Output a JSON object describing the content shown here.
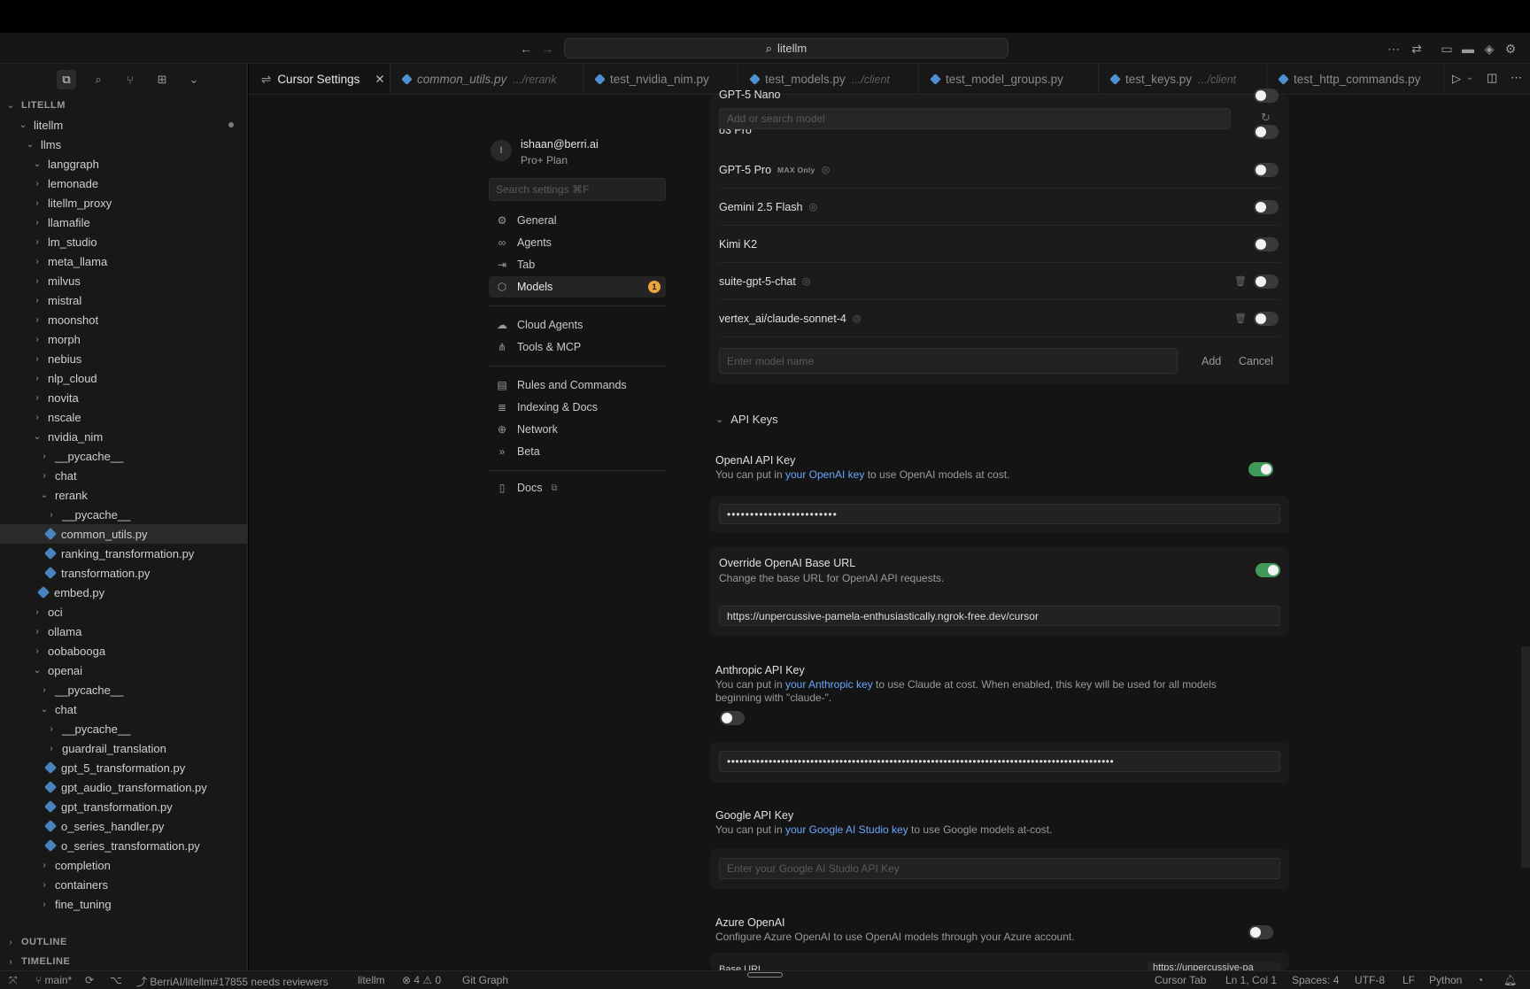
{
  "titlebar": {
    "search_text": "litellm",
    "icons": [
      "back-arrow-icon",
      "forward-arrow-icon",
      "search-icon",
      "more-icon",
      "sync-icon",
      "sidebar-toggle-icon",
      "panel-toggle-icon",
      "extensions-icon",
      "settings-gear-icon"
    ]
  },
  "sidebar": {
    "section_title": "LITELLM",
    "tree": [
      {
        "label": "litellm",
        "depth": 1,
        "type": "folder-open"
      },
      {
        "label": "llms",
        "depth": 2,
        "type": "folder-open"
      },
      {
        "label": "langgraph",
        "depth": 3,
        "type": "folder-open"
      },
      {
        "label": "lemonade",
        "depth": 3,
        "type": "folder"
      },
      {
        "label": "litellm_proxy",
        "depth": 3,
        "type": "folder"
      },
      {
        "label": "llamafile",
        "depth": 3,
        "type": "folder"
      },
      {
        "label": "lm_studio",
        "depth": 3,
        "type": "folder"
      },
      {
        "label": "meta_llama",
        "depth": 3,
        "type": "folder"
      },
      {
        "label": "milvus",
        "depth": 3,
        "type": "folder"
      },
      {
        "label": "mistral",
        "depth": 3,
        "type": "folder"
      },
      {
        "label": "moonshot",
        "depth": 3,
        "type": "folder"
      },
      {
        "label": "morph",
        "depth": 3,
        "type": "folder"
      },
      {
        "label": "nebius",
        "depth": 3,
        "type": "folder"
      },
      {
        "label": "nlp_cloud",
        "depth": 3,
        "type": "folder"
      },
      {
        "label": "novita",
        "depth": 3,
        "type": "folder"
      },
      {
        "label": "nscale",
        "depth": 3,
        "type": "folder"
      },
      {
        "label": "nvidia_nim",
        "depth": 3,
        "type": "folder-open"
      },
      {
        "label": "__pycache__",
        "depth": 4,
        "type": "folder"
      },
      {
        "label": "chat",
        "depth": 4,
        "type": "folder"
      },
      {
        "label": "rerank",
        "depth": 4,
        "type": "folder-open"
      },
      {
        "label": "__pycache__",
        "depth": 5,
        "type": "folder"
      },
      {
        "label": "common_utils.py",
        "depth": 5,
        "type": "file",
        "selected": true
      },
      {
        "label": "ranking_transformation.py",
        "depth": 5,
        "type": "file"
      },
      {
        "label": "transformation.py",
        "depth": 5,
        "type": "file"
      },
      {
        "label": "embed.py",
        "depth": 4,
        "type": "file"
      },
      {
        "label": "oci",
        "depth": 3,
        "type": "folder"
      },
      {
        "label": "ollama",
        "depth": 3,
        "type": "folder"
      },
      {
        "label": "oobabooga",
        "depth": 3,
        "type": "folder"
      },
      {
        "label": "openai",
        "depth": 3,
        "type": "folder-open"
      },
      {
        "label": "__pycache__",
        "depth": 4,
        "type": "folder"
      },
      {
        "label": "chat",
        "depth": 4,
        "type": "folder-open"
      },
      {
        "label": "__pycache__",
        "depth": 5,
        "type": "folder"
      },
      {
        "label": "guardrail_translation",
        "depth": 5,
        "type": "folder"
      },
      {
        "label": "gpt_5_transformation.py",
        "depth": 5,
        "type": "file"
      },
      {
        "label": "gpt_audio_transformation.py",
        "depth": 5,
        "type": "file"
      },
      {
        "label": "gpt_transformation.py",
        "depth": 5,
        "type": "file"
      },
      {
        "label": "o_series_handler.py",
        "depth": 5,
        "type": "file"
      },
      {
        "label": "o_series_transformation.py",
        "depth": 5,
        "type": "file"
      },
      {
        "label": "completion",
        "depth": 4,
        "type": "folder"
      },
      {
        "label": "containers",
        "depth": 4,
        "type": "folder"
      },
      {
        "label": "fine_tuning",
        "depth": 4,
        "type": "folder"
      }
    ],
    "outline_label": "OUTLINE",
    "timeline_label": "TIMELINE"
  },
  "tabs": [
    {
      "name": "Cursor Settings",
      "sub": "",
      "active": true
    },
    {
      "name": "common_utils.py",
      "sub": ".../rerank",
      "italic": true
    },
    {
      "name": "test_nvidia_nim.py",
      "sub": ""
    },
    {
      "name": "test_models.py",
      "sub": ".../client"
    },
    {
      "name": "test_model_groups.py",
      "sub": ""
    },
    {
      "name": "test_keys.py",
      "sub": ".../client"
    },
    {
      "name": "test_http_commands.py",
      "sub": ""
    }
  ],
  "settings_nav": {
    "avatar_initial": "I",
    "email": "ishaan@berri.ai",
    "plan": "Pro+ Plan",
    "search_placeholder": "Search settings ⌘F",
    "items": [
      {
        "label": "General",
        "icon": "gear-icon"
      },
      {
        "label": "Agents",
        "icon": "infinity-icon"
      },
      {
        "label": "Tab",
        "icon": "tab-arrow-icon"
      },
      {
        "label": "Models",
        "icon": "cube-icon",
        "badge": "1"
      },
      {
        "label": "Cloud Agents",
        "icon": "cloud-icon"
      },
      {
        "label": "Tools & MCP",
        "icon": "tools-icon"
      },
      {
        "label": "Rules and Commands",
        "icon": "document-icon"
      },
      {
        "label": "Indexing & Docs",
        "icon": "database-icon"
      },
      {
        "label": "Network",
        "icon": "globe-icon"
      },
      {
        "label": "Beta",
        "icon": "beta-icon"
      },
      {
        "label": "Docs",
        "icon": "book-icon"
      }
    ]
  },
  "models": {
    "search_placeholder": "Add or search model",
    "partial_top": "GPT-5 Nano",
    "partial_second": "o3 Pro",
    "max_only_label": "MAX Only",
    "rows": [
      {
        "name": "GPT-5 Pro",
        "max_only": true,
        "brain": true,
        "trash": false
      },
      {
        "name": "Gemini 2.5 Flash",
        "max_only": false,
        "brain": true,
        "trash": false
      },
      {
        "name": "Kimi K2",
        "max_only": false,
        "brain": false,
        "trash": false
      },
      {
        "name": "suite-gpt-5-chat",
        "max_only": false,
        "brain": true,
        "trash": true
      },
      {
        "name": "vertex_ai/claude-sonnet-4",
        "max_only": false,
        "brain": true,
        "trash": true
      }
    ],
    "add_model_placeholder": "Enter model name",
    "add_label": "Add",
    "cancel_label": "Cancel"
  },
  "api_keys": {
    "section_title": "API Keys",
    "openai": {
      "title": "OpenAI API Key",
      "desc_pre": "You can put in ",
      "desc_link": "your OpenAI key",
      "desc_post": " to use OpenAI models at cost.",
      "value": "••••••••••••••••••••••••",
      "enabled": true
    },
    "override": {
      "title": "Override OpenAI Base URL",
      "desc": "Change the base URL for OpenAI API requests.",
      "value": "https://unpercussive-pamela-enthusiastically.ngrok-free.dev/cursor",
      "enabled": true
    },
    "anthropic": {
      "title": "Anthropic API Key",
      "desc_pre": "You can put in ",
      "desc_link": "your Anthropic key",
      "desc_post": " to use Claude at cost. When enabled, this key will be used for all models beginning with \"claude-\".",
      "value": "•••••••••••••••••••••••••••••••••••••••••••••••••••••••••••••••••••••••••••••••••••••••••••••",
      "enabled": false
    },
    "google": {
      "title": "Google API Key",
      "desc_pre": "You can put in ",
      "desc_link": "your Google AI Studio key",
      "desc_post": " to use Google models at-cost.",
      "placeholder": "Enter your Google AI Studio API Key"
    },
    "azure": {
      "title": "Azure OpenAI",
      "desc": "Configure Azure OpenAI to use OpenAI models through your Azure account.",
      "enabled": false,
      "partial_label": "Base URL",
      "partial_value": "https://unpercussive-pa"
    }
  },
  "statusbar": {
    "branch": "main*",
    "pr": "BerriAI/litellm#17855 needs reviewers",
    "repo": "litellm",
    "errors": "4",
    "warnings": "0",
    "git_graph": "Git Graph",
    "cursor_tab": "Cursor Tab",
    "position": "Ln 1, Col 1",
    "spaces": "Spaces: 4",
    "encoding": "UTF-8",
    "eol": "LF",
    "language": "Python"
  },
  "colors": {
    "accent_link": "#6aa6ff",
    "toggle_on": "#3f9a5a",
    "badge": "#e8a33c",
    "python_icon": "#4f8fcf"
  }
}
